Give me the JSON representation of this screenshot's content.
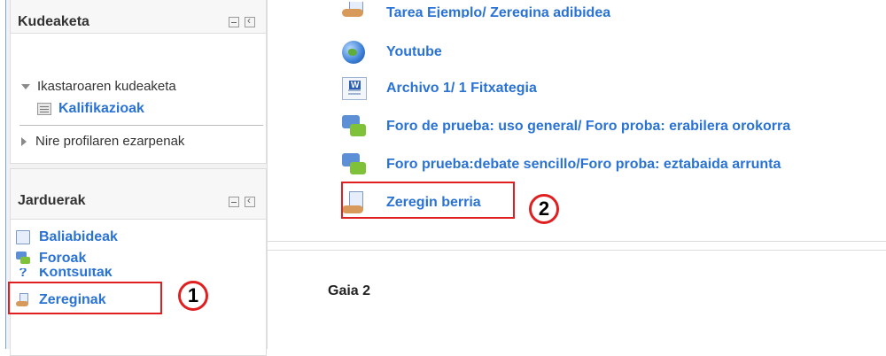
{
  "sidebar": {
    "admin_block": {
      "title": "Kudeaketa",
      "items": [
        {
          "label": "Ikastaroaren kudeaketa",
          "icon": "triangle-down-icon"
        },
        {
          "label": "Kalifikazioak",
          "icon": "grades-icon"
        },
        {
          "label": "Nire profilaren ezarpenak",
          "icon": "triangle-right-icon"
        }
      ]
    },
    "activities_block": {
      "title": "Jarduerak",
      "items": [
        {
          "label": "Baliabideak",
          "icon": "resource-icon"
        },
        {
          "label": "Foroak",
          "icon": "forum-icon"
        },
        {
          "label": "Kontsultak",
          "icon": "quiz-icon"
        },
        {
          "label": "Zereginak",
          "icon": "assignment-icon"
        }
      ]
    }
  },
  "main": {
    "section1": {
      "modules": [
        {
          "label": "Tarea Ejemplo/ Zeregina adibidea",
          "icon": "assignment-icon"
        },
        {
          "label": "Youtube",
          "icon": "url-icon"
        },
        {
          "label": "Archivo 1/ 1 Fitxategia",
          "icon": "word-file-icon"
        },
        {
          "label": "Foro de prueba: uso general/ Foro proba: erabilera orokorra",
          "icon": "forum-icon"
        },
        {
          "label": "Foro prueba:debate sencillo/Foro proba: eztabaida arrunta",
          "icon": "forum-icon"
        },
        {
          "label": "Zeregin berria",
          "icon": "assignment-icon"
        }
      ]
    },
    "section2": {
      "title": "Gaia 2"
    }
  },
  "annotations": {
    "first": "1",
    "second": "2",
    "color": "#e02020"
  },
  "colors": {
    "link": "#2a73d4",
    "sidebar_bg": "#f2f2f2"
  }
}
